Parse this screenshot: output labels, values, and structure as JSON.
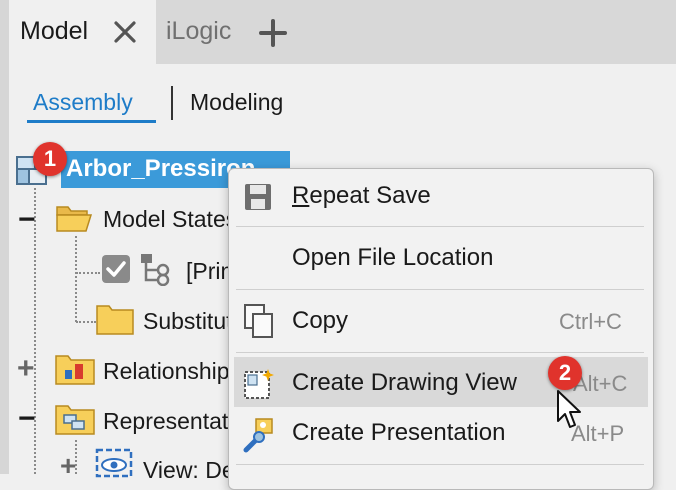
{
  "tabs": {
    "model_label": "Model",
    "ilogic_label": "iLogic"
  },
  "subtabs": {
    "assembly_label": "Assembly",
    "modeling_label": "Modeling"
  },
  "tree": {
    "root_label": "Arbor_Pressiron",
    "model_states_label": "Model States",
    "primary_label": "[Primary]",
    "substitutes_label": "Substitutes",
    "relationships_label": "Relationships",
    "representations_label": "Representations",
    "view_label": "View: Default",
    "expand_symbol": "+",
    "collapse_symbol": "−"
  },
  "context_menu": {
    "items": [
      {
        "label": "Repeat Save",
        "mnemonic": "R",
        "rest": "epeat Save",
        "shortcut": ""
      },
      {
        "label": "Open File Location",
        "shortcut": ""
      },
      {
        "label": "Copy",
        "shortcut": "Ctrl+C"
      },
      {
        "label": "Create Drawing View",
        "shortcut": "Alt+C"
      },
      {
        "label": "Create Presentation",
        "shortcut": "Alt+P"
      }
    ]
  },
  "badges": {
    "step1": "1",
    "step2": "2"
  },
  "colors": {
    "accent": "#1e7cc8",
    "selection": "#3b9ad9",
    "badge": "#e0332c",
    "folder": "#f7cf5a"
  }
}
